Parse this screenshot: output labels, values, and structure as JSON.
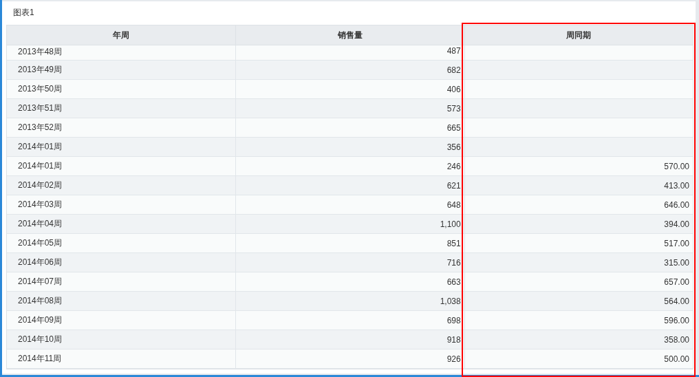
{
  "panel": {
    "title": "图表1"
  },
  "table": {
    "columns": [
      {
        "label": "年周",
        "kind": "text",
        "highlighted": false
      },
      {
        "label": "销售量",
        "kind": "number",
        "highlighted": false
      },
      {
        "label": "周同期",
        "kind": "number",
        "highlighted": true
      }
    ],
    "rows": [
      [
        "2013年48周",
        "487",
        ""
      ],
      [
        "2013年49周",
        "682",
        ""
      ],
      [
        "2013年50周",
        "406",
        ""
      ],
      [
        "2013年51周",
        "573",
        ""
      ],
      [
        "2013年52周",
        "665",
        ""
      ],
      [
        "2014年01周",
        "356",
        ""
      ],
      [
        "2014年01周",
        "246",
        "570.00"
      ],
      [
        "2014年02周",
        "621",
        "413.00"
      ],
      [
        "2014年03周",
        "648",
        "646.00"
      ],
      [
        "2014年04周",
        "1,100",
        "394.00"
      ],
      [
        "2014年05周",
        "851",
        "517.00"
      ],
      [
        "2014年06周",
        "716",
        "315.00"
      ],
      [
        "2014年07周",
        "663",
        "657.00"
      ],
      [
        "2014年08周",
        "1,038",
        "564.00"
      ],
      [
        "2014年09周",
        "698",
        "596.00"
      ],
      [
        "2014年10周",
        "918",
        "358.00"
      ],
      [
        "2014年11周",
        "926",
        "500.00"
      ]
    ]
  }
}
